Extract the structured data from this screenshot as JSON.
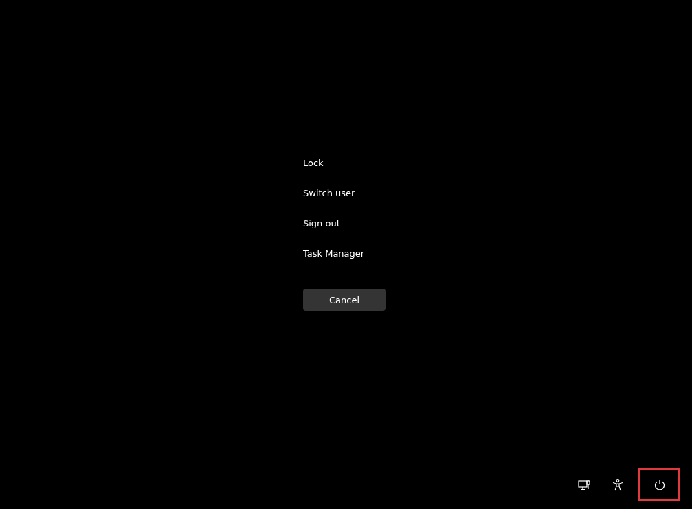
{
  "menu": {
    "items": [
      "Lock",
      "Switch user",
      "Sign out",
      "Task Manager"
    ]
  },
  "cancel_button": "Cancel",
  "bottom_buttons": [
    {
      "kind": "network",
      "highlighted": false
    },
    {
      "kind": "accessibility",
      "highlighted": false
    },
    {
      "kind": "power",
      "highlighted": true
    }
  ]
}
